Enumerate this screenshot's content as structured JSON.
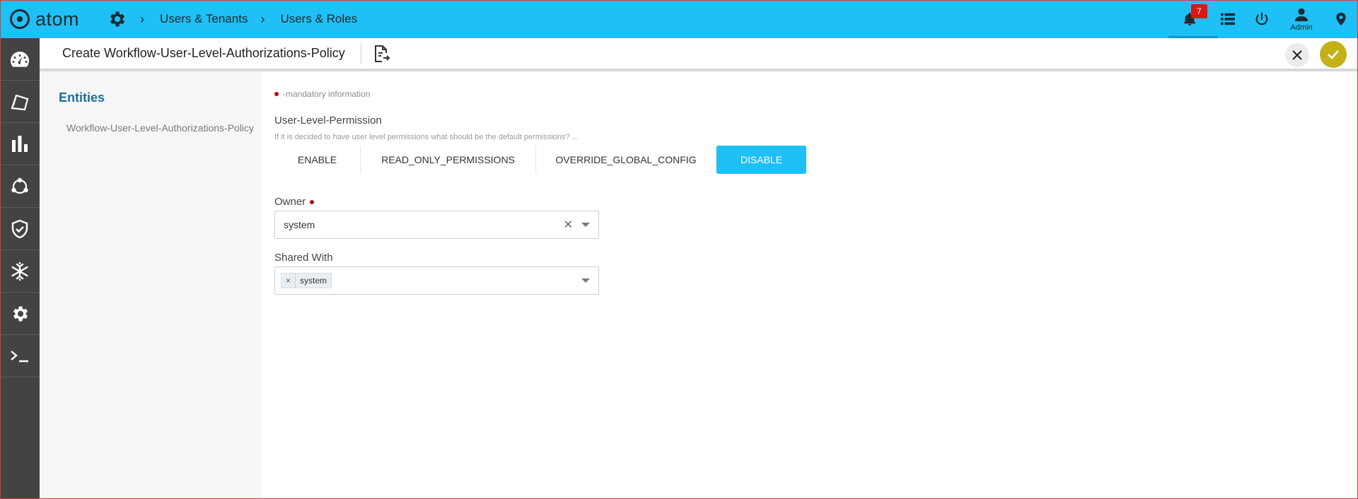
{
  "app": {
    "logo_text": "atom"
  },
  "breadcrumb": [
    "Users & Tenants",
    "Users & Roles"
  ],
  "topbar": {
    "notification_count": "7",
    "admin_label": "Admin",
    "icons": [
      "bell-icon",
      "list-icon",
      "power-icon",
      "user-icon",
      "location-pin-icon"
    ]
  },
  "sidebar": {
    "items": [
      "dashboard-icon",
      "pages-icon",
      "bar-chart-icon",
      "network-icon",
      "shield-check-icon",
      "snowflake-icon",
      "gear-icon",
      "terminal-icon"
    ]
  },
  "header": {
    "title": "Create Workflow-User-Level-Authorizations-Policy"
  },
  "entities": {
    "title": "Entities",
    "items": [
      "Workflow-User-Level-Authorizations-Policy"
    ]
  },
  "form": {
    "mandatory_note": "-mandatory information",
    "permission": {
      "label": "User-Level-Permission",
      "hint": "If it is decided to have user level permissions what should be the default permissions? ...",
      "options": [
        "ENABLE",
        "READ_ONLY_PERMISSIONS",
        "OVERRIDE_GLOBAL_CONFIG",
        "DISABLE"
      ],
      "selected": "DISABLE"
    },
    "owner": {
      "label": "Owner",
      "value": "system"
    },
    "shared_with": {
      "label": "Shared With",
      "chips": [
        "system"
      ]
    }
  },
  "colors": {
    "topbar": "#1ec0f5",
    "sidebar": "#434343",
    "selected_option": "#1ec0f5",
    "confirm_button": "#c2b218",
    "mandatory_dot": "#b50d0d",
    "entities_title": "#1e6f9a"
  }
}
